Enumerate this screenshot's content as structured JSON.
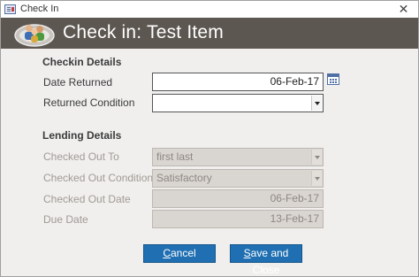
{
  "window": {
    "title": "Check In",
    "close_glyph": "✕"
  },
  "header": {
    "title": "Check in: Test Item",
    "icon": "people-icon"
  },
  "checkin": {
    "heading": "Checkin Details",
    "date_returned_label": "Date Returned",
    "date_returned_value": "06-Feb-17",
    "returned_condition_label": "Returned Condition",
    "returned_condition_value": ""
  },
  "lending": {
    "heading": "Lending Details",
    "checked_out_to_label": "Checked Out To",
    "checked_out_to_value": "first last",
    "checked_out_condition_label": "Checked Out Condition",
    "checked_out_condition_value": "Satisfactory",
    "checked_out_date_label": "Checked Out Date",
    "checked_out_date_value": "06-Feb-17",
    "due_date_label": "Due Date",
    "due_date_value": "13-Feb-17"
  },
  "buttons": {
    "cancel_first": "C",
    "cancel_rest": "ancel",
    "save_first": "S",
    "save_rest": "ave and Close"
  },
  "colors": {
    "header_bg": "#5d5751",
    "button_bg": "#1f6fb2",
    "body_bg": "#f0efee"
  }
}
